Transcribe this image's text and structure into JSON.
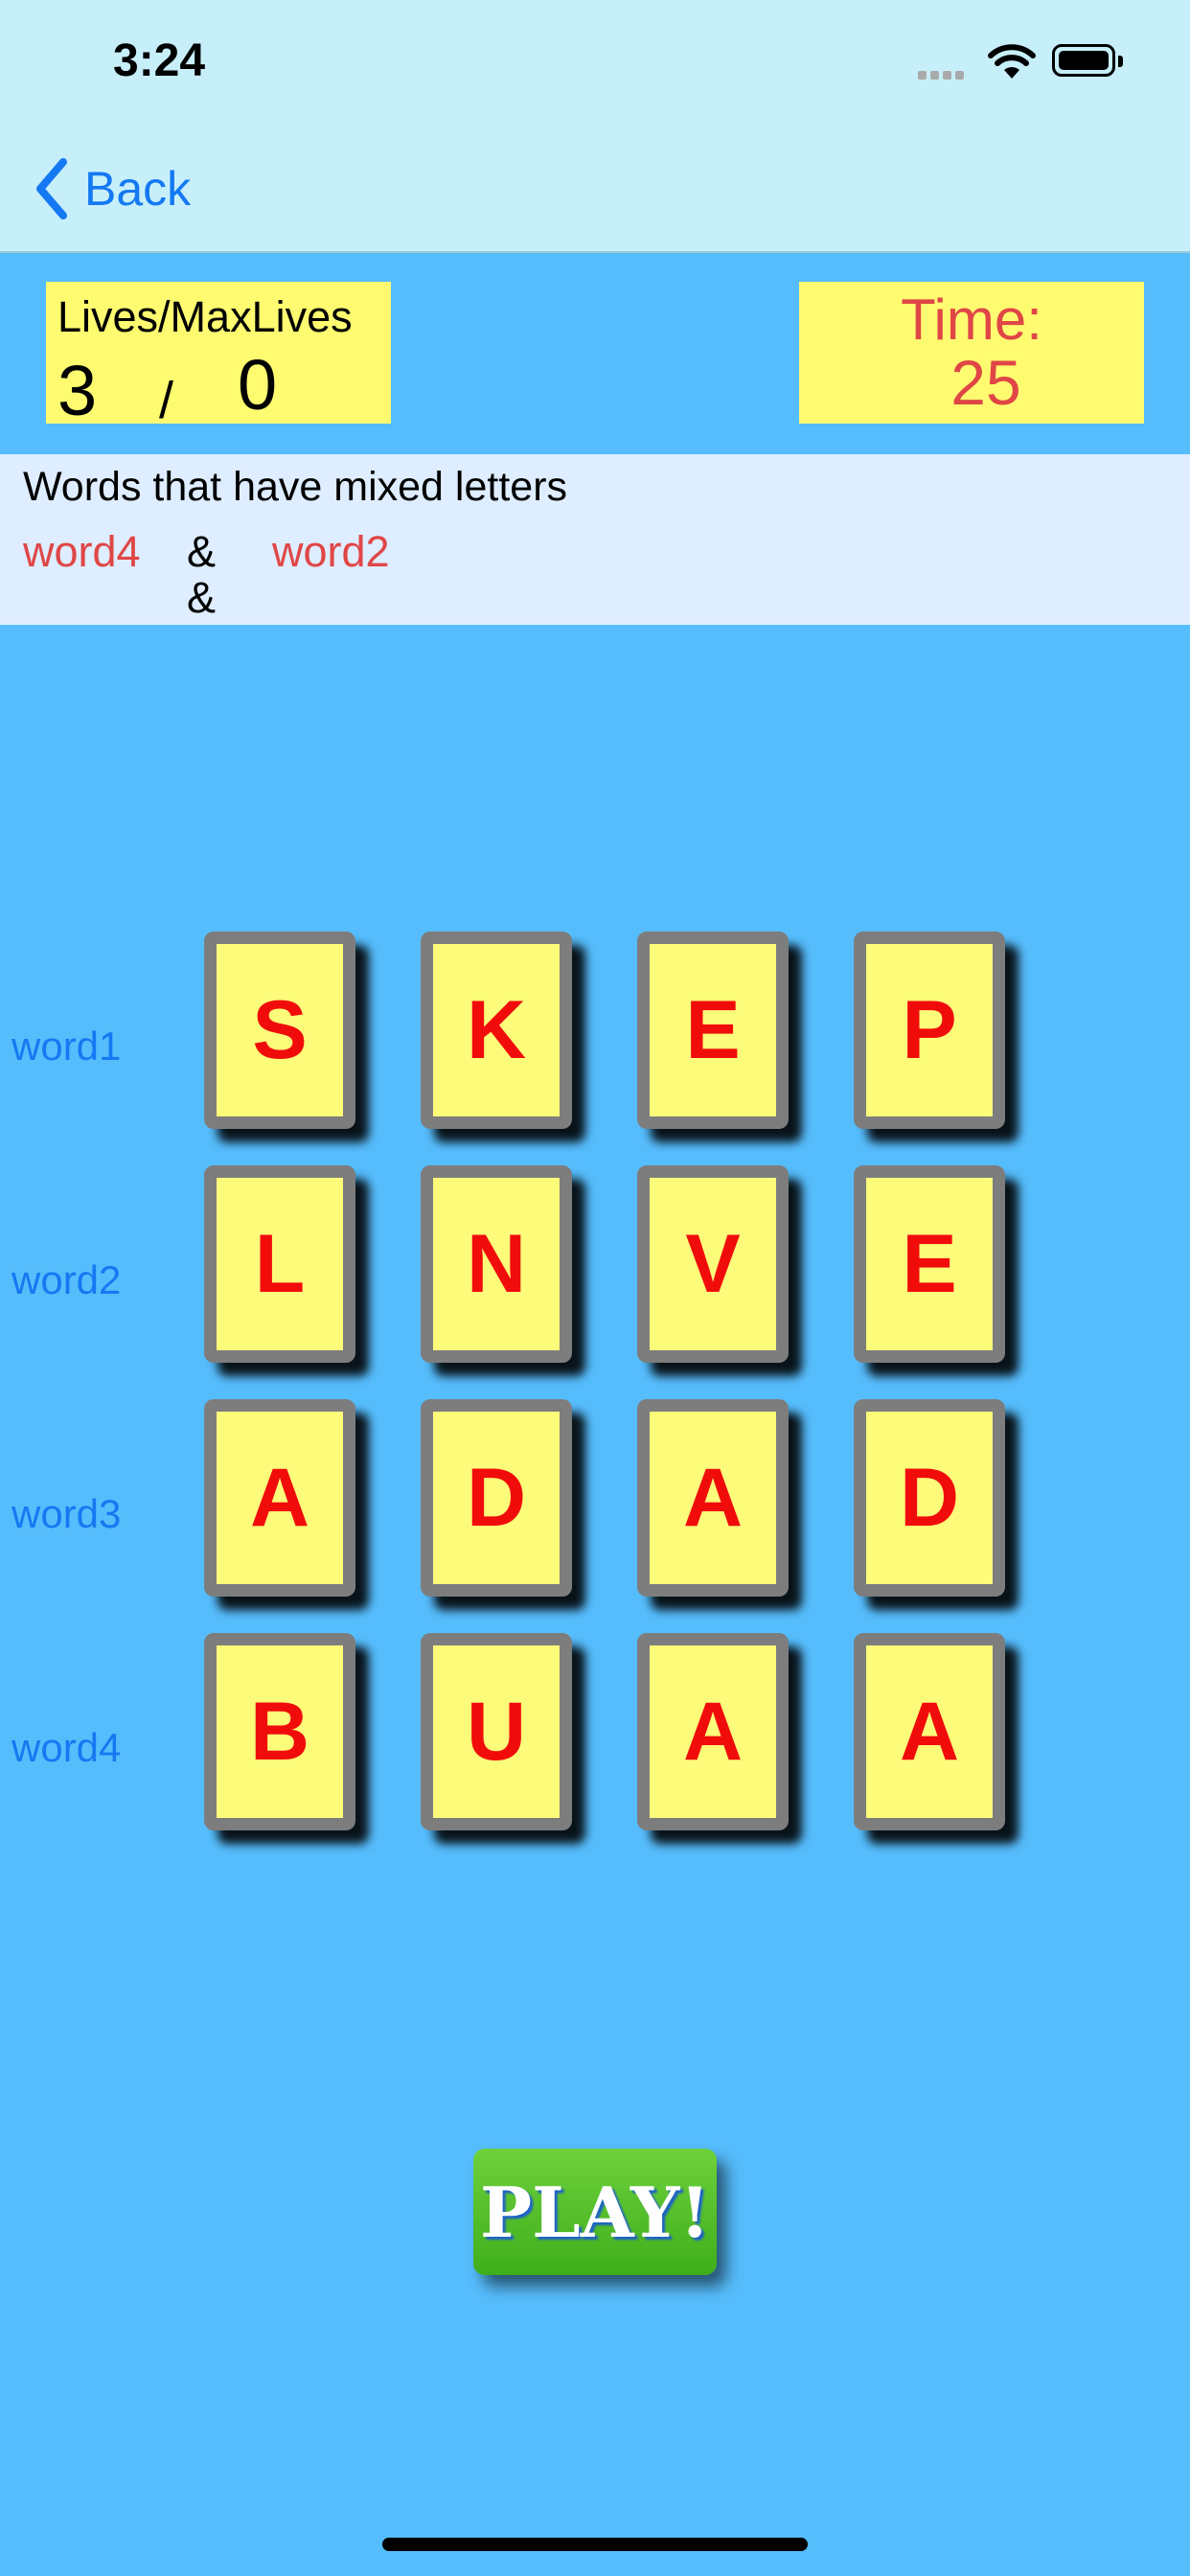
{
  "status_bar": {
    "time": "3:24"
  },
  "nav": {
    "back_label": "Back",
    "back_icon": "chevron-left-icon"
  },
  "lives": {
    "title": "Lives/MaxLives",
    "current": "3",
    "separator": "/",
    "max": "0"
  },
  "timer": {
    "label": "Time:",
    "value": "25"
  },
  "mixed_info": {
    "title": "Words that have mixed letters",
    "word_a": "word4",
    "amp_a": "&",
    "amp_b": "&",
    "word_b": "word2"
  },
  "grid": {
    "rows": [
      {
        "label": "word1",
        "letters": [
          "S",
          "K",
          "E",
          "P"
        ]
      },
      {
        "label": "word2",
        "letters": [
          "L",
          "N",
          "V",
          "E"
        ]
      },
      {
        "label": "word3",
        "letters": [
          "A",
          "D",
          "A",
          "D"
        ]
      },
      {
        "label": "word4",
        "letters": [
          "B",
          "U",
          "A",
          "A"
        ]
      }
    ]
  },
  "play_button": {
    "label": "PLAY!"
  },
  "colors": {
    "background": "#56bdfd",
    "tile": "#fdfb7a",
    "letter": "#f10c0c",
    "play": "#4fc027",
    "accent": "#1479f2"
  }
}
